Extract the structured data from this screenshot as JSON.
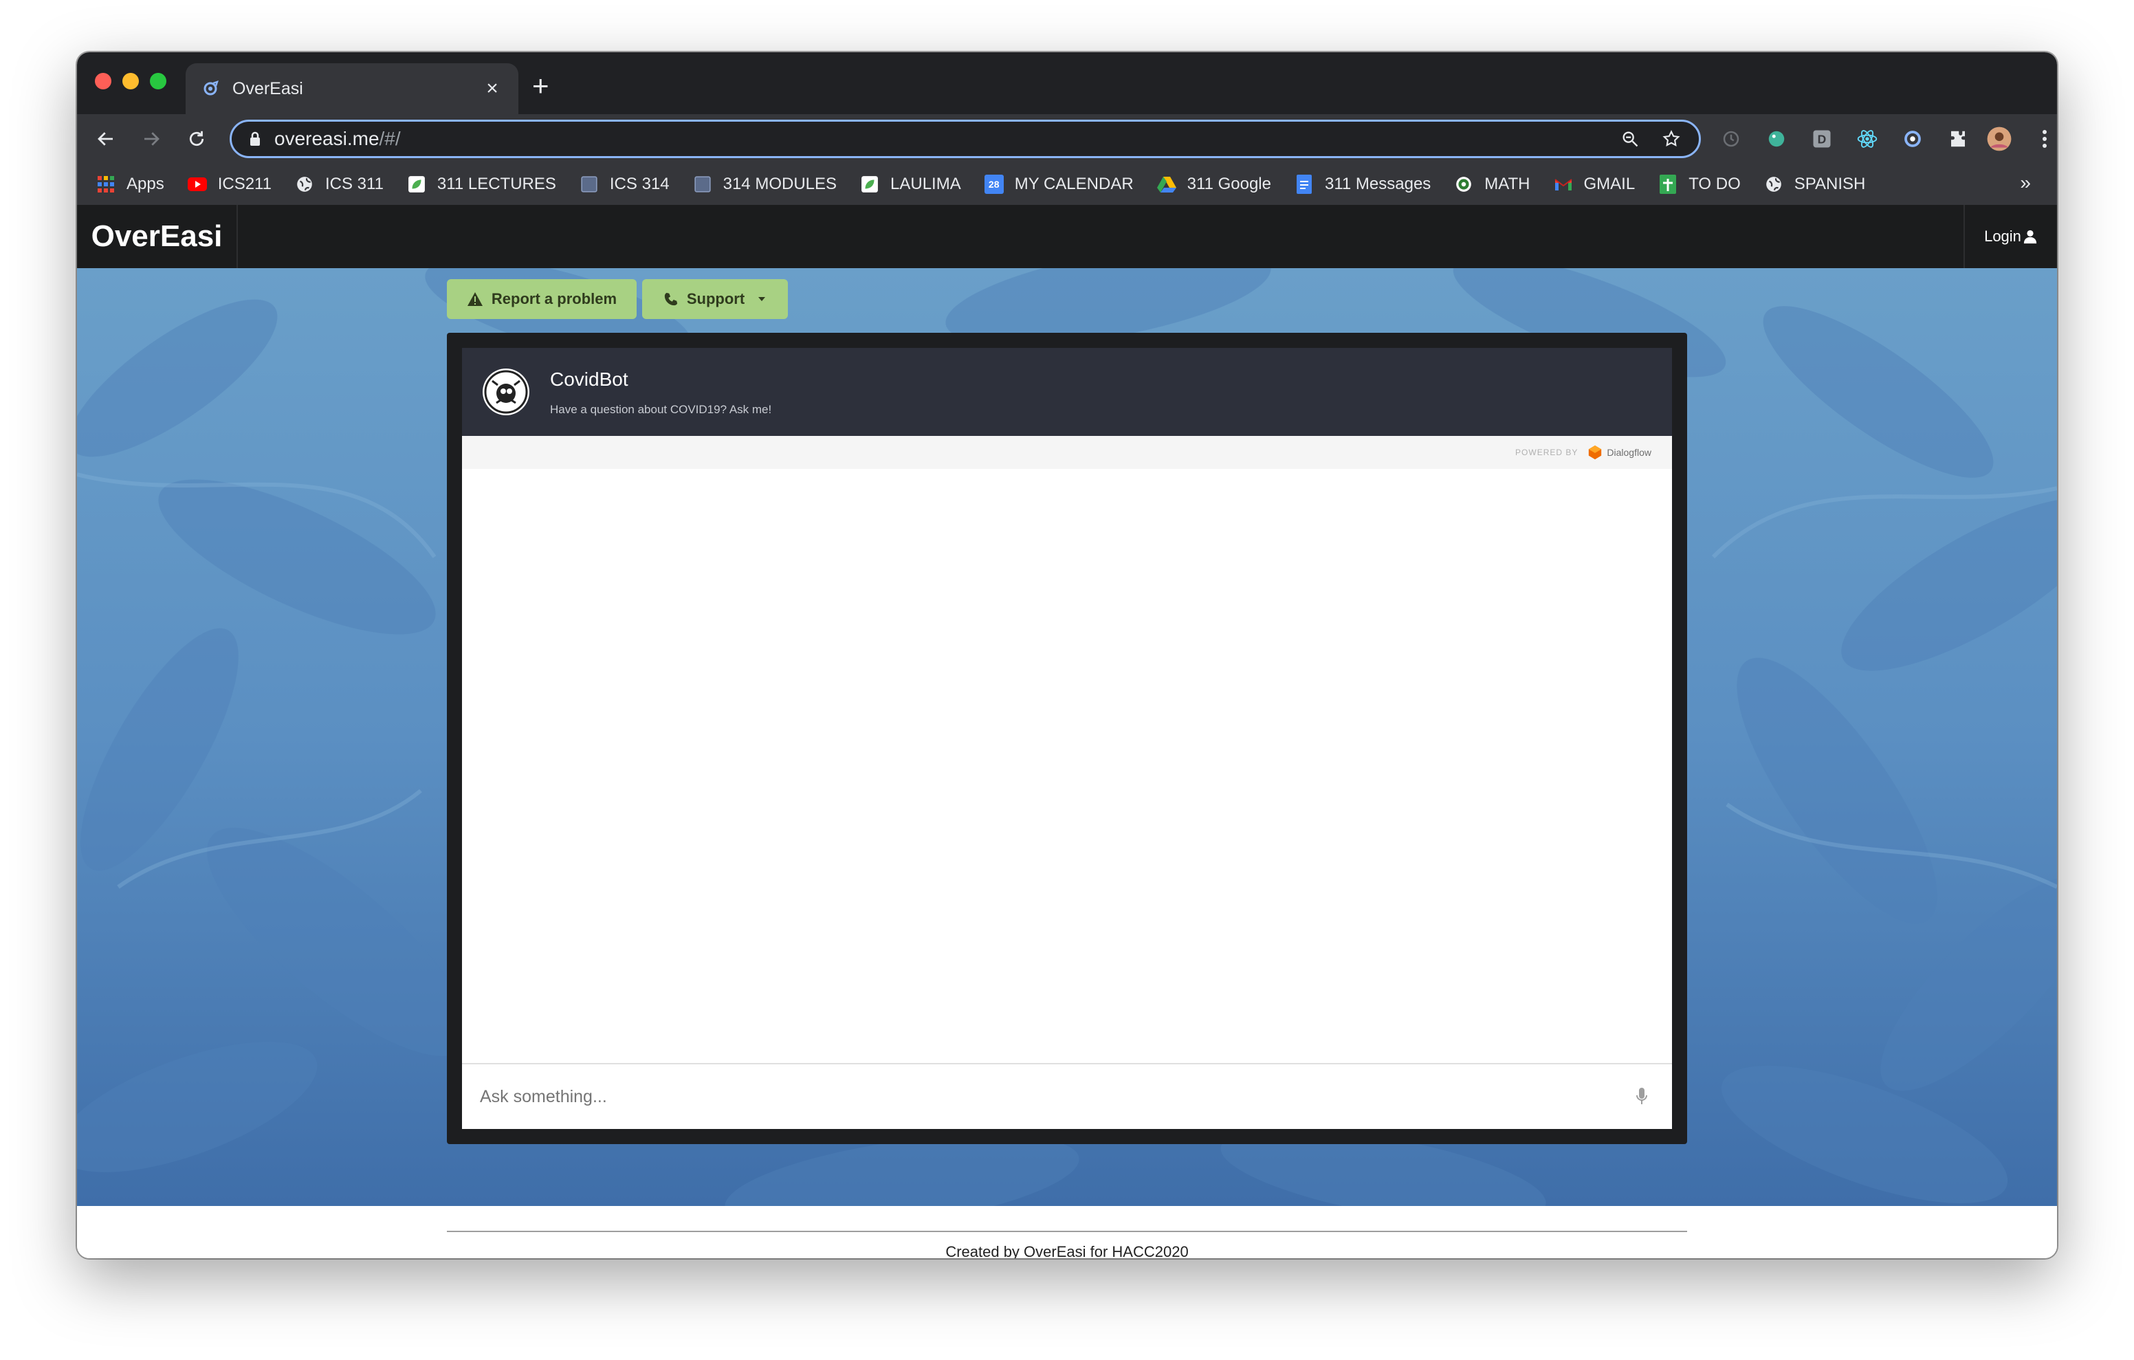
{
  "browser": {
    "tab_title": "OverEasi",
    "url_host": "overeasi.me",
    "url_path": "/#/",
    "bookmarks": [
      {
        "label": "Apps",
        "icon": "apps-grid-icon"
      },
      {
        "label": "ICS211",
        "icon": "youtube-icon"
      },
      {
        "label": "ICS 311",
        "icon": "globe-icon"
      },
      {
        "label": "311 LECTURES",
        "icon": "leaf-icon"
      },
      {
        "label": "ICS 314",
        "icon": "square-icon"
      },
      {
        "label": "314 MODULES",
        "icon": "square-icon"
      },
      {
        "label": "LAULIMA",
        "icon": "leaf-icon"
      },
      {
        "label": "MY CALENDAR",
        "icon": "calendar-icon"
      },
      {
        "label": "311 Google",
        "icon": "drive-icon"
      },
      {
        "label": "311 Messages",
        "icon": "docs-icon"
      },
      {
        "label": "MATH",
        "icon": "math-icon"
      },
      {
        "label": "GMAIL",
        "icon": "gmail-icon"
      },
      {
        "label": "TO DO",
        "icon": "sheets-icon"
      },
      {
        "label": "SPANISH",
        "icon": "globe-icon"
      }
    ],
    "calendar_day": "28",
    "more_label": "»"
  },
  "app": {
    "brand": "OverEasi",
    "login_label": "Login",
    "report_label": "Report a problem",
    "support_label": "Support"
  },
  "chat": {
    "bot_name": "CovidBot",
    "bot_subtitle": "Have a question about COVID19? Ask me!",
    "powered_by": "POWERED BY",
    "provider": "Dialogflow",
    "input_placeholder": "Ask something..."
  },
  "footer": {
    "text": "Created by OverEasi for HACC2020"
  },
  "colors": {
    "accent_green": "#a8d183",
    "chat_header": "#2d303b",
    "navbar": "#1b1c1d"
  }
}
